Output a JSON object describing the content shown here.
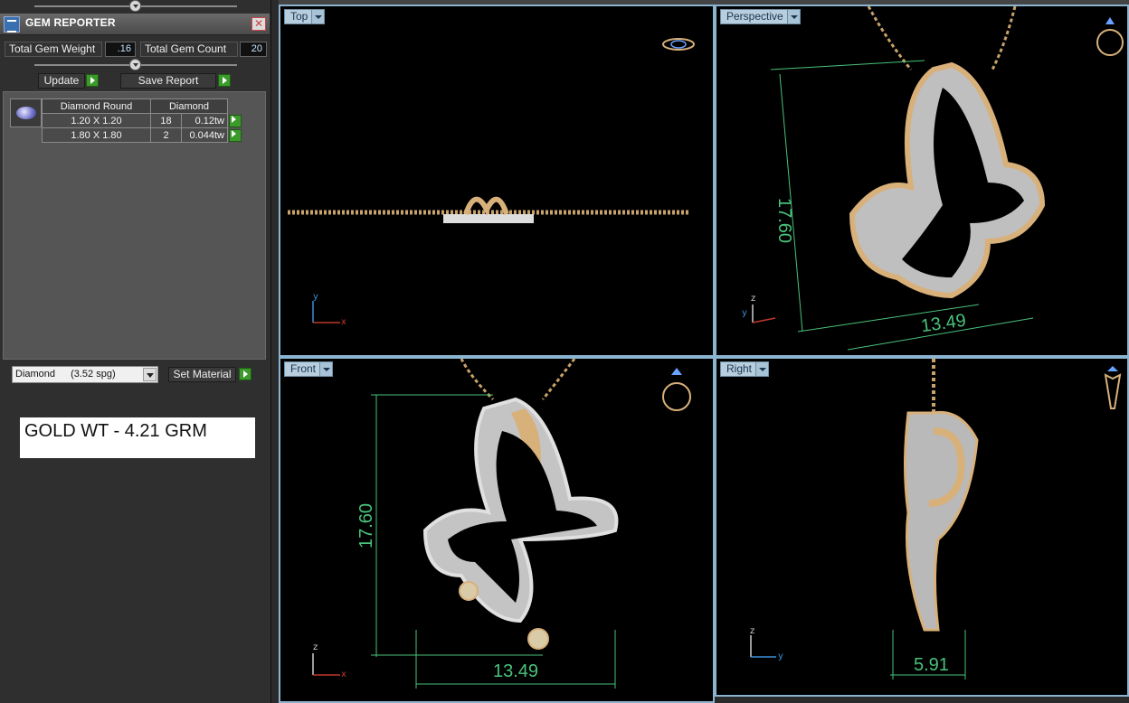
{
  "panel": {
    "title": "GEM REPORTER",
    "close_glyph": "✕",
    "total_weight_label": "Total Gem Weight",
    "total_weight_value": ".16",
    "total_count_label": "Total Gem Count",
    "total_count_value": "20",
    "update_label": "Update",
    "save_report_label": "Save Report",
    "table": {
      "headers": [
        "Diamond Round",
        "Diamond"
      ],
      "rows": [
        {
          "size": "1.20 X 1.20",
          "count": "18",
          "weight": "0.12tw"
        },
        {
          "size": "1.80 X 1.80",
          "count": "2",
          "weight": "0.044tw"
        }
      ]
    },
    "material_select": {
      "name": "Diamond",
      "density": "(3.52 spg)"
    },
    "set_material_label": "Set Material",
    "gold_weight_note": "GOLD WT - 4.21 GRM"
  },
  "viewports": {
    "top": {
      "label": "Top"
    },
    "perspective": {
      "label": "Perspective",
      "height_dim": "17.60",
      "width_dim": "13.49"
    },
    "front": {
      "label": "Front",
      "height_dim": "17.60",
      "width_dim": "13.49"
    },
    "right": {
      "label": "Right",
      "width_dim": "5.91"
    }
  },
  "axes": {
    "x": "x",
    "y": "y",
    "z": "z"
  },
  "icons": {
    "viewport_menu": "chevron-down-icon",
    "ring_orientation": "ring-icon",
    "gem": "diamond-round-icon"
  },
  "colors": {
    "viewport_border": "#8ab4d0",
    "tab_bg": "#b8cede",
    "dimension_green": "#49c27a",
    "axis_x": "#c0392b",
    "axis_y": "#3a8fd6",
    "go_green": "#3b9a2b",
    "gold": "#d8b07a"
  }
}
